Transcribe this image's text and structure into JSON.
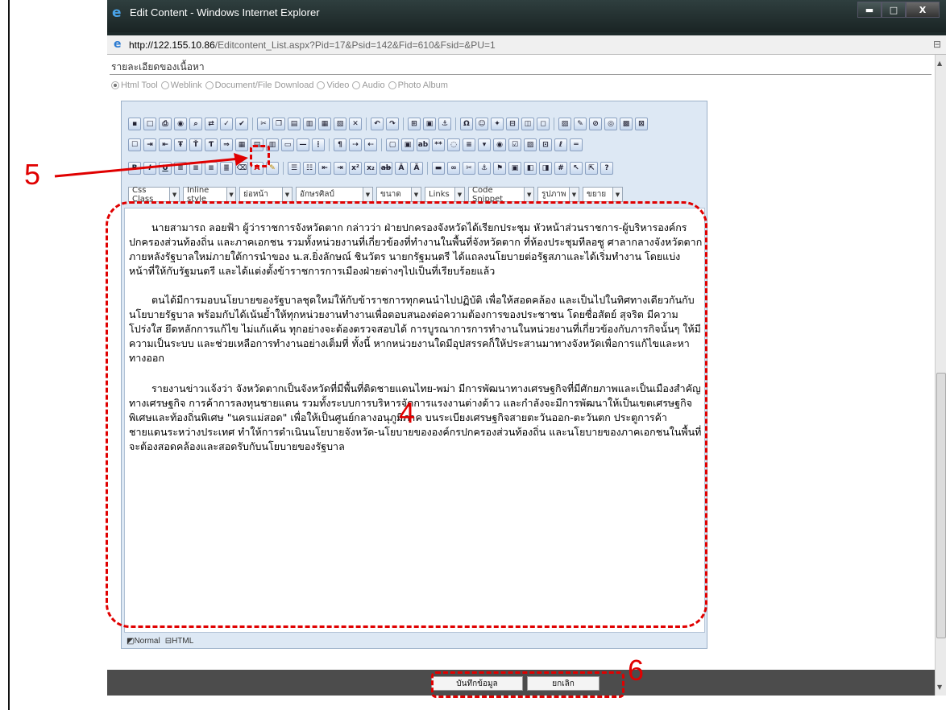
{
  "window": {
    "title": "Edit Content - Windows Internet Explorer",
    "controls": {
      "minimize": "▬",
      "maximize": "□",
      "close": "X"
    }
  },
  "address": {
    "host": "http://122.155.10.86",
    "path": "/Editcontent_List.aspx?Pid=17&Psid=142&Fid=610&Fsid=&PU=1"
  },
  "section_title": "รายละเอียดของเนื้อหา",
  "content_types": [
    {
      "label": "Html Tool",
      "selected": true
    },
    {
      "label": "Weblink",
      "selected": false
    },
    {
      "label": "Document/File Download",
      "selected": false
    },
    {
      "label": "Video",
      "selected": false
    },
    {
      "label": "Audio",
      "selected": false
    },
    {
      "label": "Photo Album",
      "selected": false
    }
  ],
  "toolbar": {
    "dropdowns": [
      "Css Class",
      "Inline style",
      "ย่อหน้า",
      "อักษรศิลป์",
      "ขนาด",
      "Links",
      "Code Snippet",
      "รูปภาพ",
      "ขยาย"
    ],
    "icon_glyphs": {
      "bold": "B",
      "italic": "I",
      "underline": "U",
      "font_color": "A",
      "superscript": "x²",
      "subscript": "x₂",
      "eraser": "⌫"
    }
  },
  "editor": {
    "paragraphs": [
      "นายสามารถ ลอยฟ้า ผู้ว่าราชการจังหวัดตาก กล่าวว่า ฝ่ายปกครองจังหวัดได้เรียกประชุม หัวหน้าส่วนราชการ-ผู้บริหารองค์กรปกครองส่วนท้องถิ่น และภาคเอกชน รวมทั้งหน่วยงานที่เกี่ยวข้องที่ทำงานในพื้นที่จังหวัดตาก ที่ห้องประชุมทีลอซู ศาลากลางจังหวัดตาก ภายหลังรัฐบาลใหม่ภายใต้การนำของ น.ส.ยิ่งลักษณ์ ชินวัตร นายกรัฐมนตรี ได้แถลงนโยบายต่อรัฐสภาและได้เริ่มทำงาน โดยแบ่งหน้าที่ให้กับรัฐมนตรี และได้แต่งตั้งข้าราชการการเมืองฝ่ายต่างๆไปเป็นที่เรียบร้อยแล้ว",
      "ตนได้มีการมอบนโยบายของรัฐบาลชุดใหม่ให้กับข้าราชการทุกคนนำไปปฏิบัติ เพื่อให้สอดคล้อง และเป็นไปในทิศทางเดียวกันกับนโยบายรัฐบาล พร้อมกับได้เน้นย้ำให้ทุกหน่วยงานทำงานเพื่อตอบสนองต่อความต้องการของประชาชน โดยซื่อสัตย์ สุจริต มีความโปร่งใส ยึดหลักการแก้ไข ไม่แก้แค้น ทุกอย่างจะต้องตรวจสอบได้ การบูรณาการการทำงานในหน่วยงานที่เกี่ยวข้องกับภารกิจนั้นๆ ให้มีความเป็นระบบ และช่วยเหลือการทำงานอย่างเต็มที่ ทั้งนี้ หากหน่วยงานใดมีอุปสรรคก็ให้ประสานมาทางจังหวัดเพื่อการแก้ไขและหาทางออก",
      "รายงานข่าวแจ้งว่า จังหวัดตากเป็นจังหวัดที่มีพื้นที่ติดชายแดนไทย-พม่า มีการพัฒนาทางเศรษฐกิจที่มีศักยภาพและเป็นเมืองสำคัญทางเศรษฐกิจ การค้าการลงทุนชายแดน รวมทั้งระบบการบริหารจัดการแรงงานต่างด้าว และกำลังจะมีการพัฒนาให้เป็นเขตเศรษฐกิจพิเศษและท้องถิ่นพิเศษ \"นครแม่สอด\" เพื่อให้เป็นศูนย์กลางอนุภูมิภาค บนระเบียงเศรษฐกิจสายตะวันออก-ตะวันตก ประตูการค้าชายแดนระหว่างประเทศ ทำให้การดำเนินนโยบายจังหวัด-นโยบายขององค์กรปกครองส่วนท้องถิ่น และนโยบายของภาคเอกชนในพื้นที่จะต้องสอดคล้องและสอดรับกับนโยบายของรัฐบาล"
    ],
    "modes": {
      "normal": "Normal",
      "html": "HTML"
    }
  },
  "buttons": {
    "save": "บันทึกข้อมูล",
    "cancel": "ยกเลิก"
  },
  "annotations": {
    "label_4": "4",
    "label_5": "5",
    "label_6": "6",
    "color": "#e00000"
  }
}
